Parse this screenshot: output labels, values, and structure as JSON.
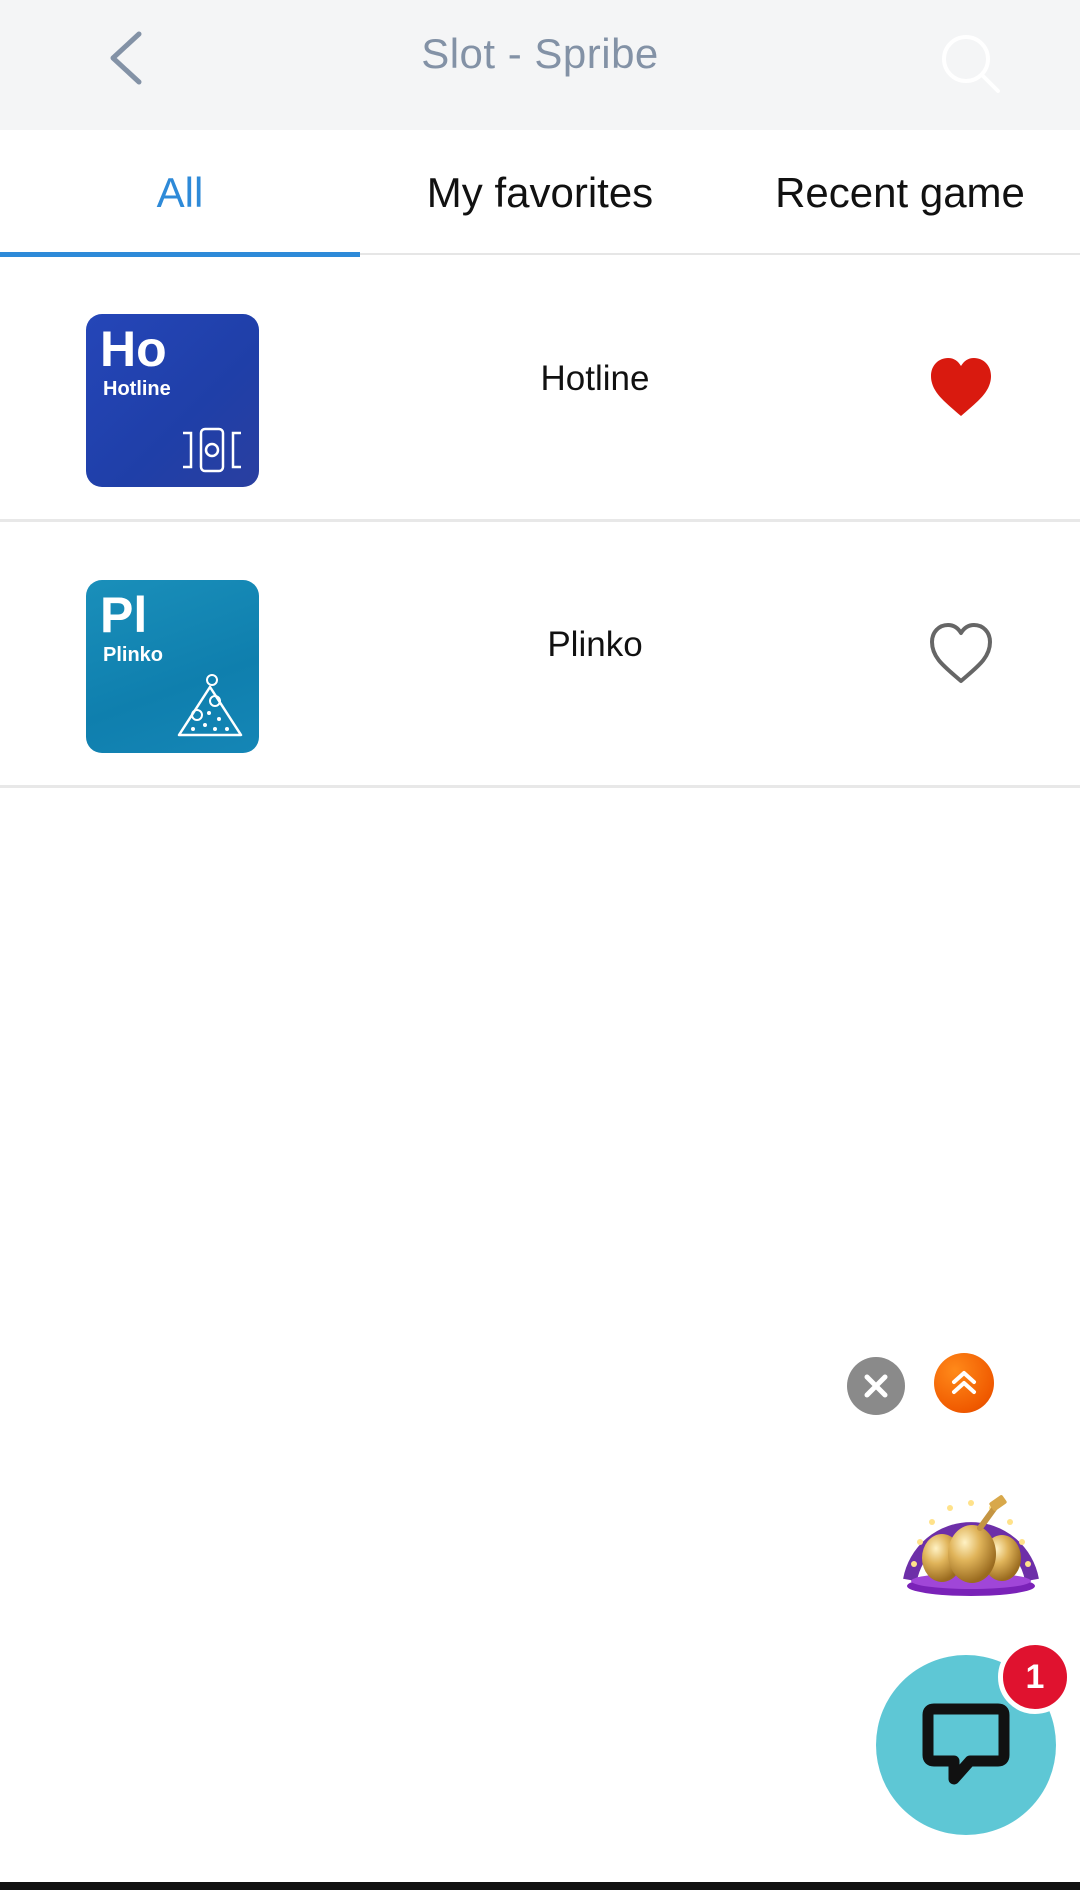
{
  "header": {
    "title": "Slot - Spribe",
    "back_icon": "chevron-left-icon",
    "search_icon": "search-icon"
  },
  "tabs": [
    {
      "label": "All",
      "active": true
    },
    {
      "label": "My favorites",
      "active": false
    },
    {
      "label": "Recent game",
      "active": false
    }
  ],
  "games": [
    {
      "abbr": "Ho",
      "thumb_name": "Hotline",
      "title": "Hotline",
      "favorite": true,
      "thumb_color": "#2546b8"
    },
    {
      "abbr": "Pl",
      "thumb_name": "Plinko",
      "title": "Plinko",
      "favorite": false,
      "thumb_color": "#1586b6"
    }
  ],
  "floating": {
    "close_icon": "close-icon",
    "scroll_top_icon": "double-chevron-up-icon",
    "promo_icon": "golden-eggs-promo-icon",
    "chat_icon": "chat-bubble-icon",
    "chat_badge_count": "1"
  },
  "colors": {
    "accent": "#2e8ad8",
    "favorite_red": "#d91a0f",
    "chat_bg": "#5ec7d5",
    "badge_red": "#e0122f"
  }
}
